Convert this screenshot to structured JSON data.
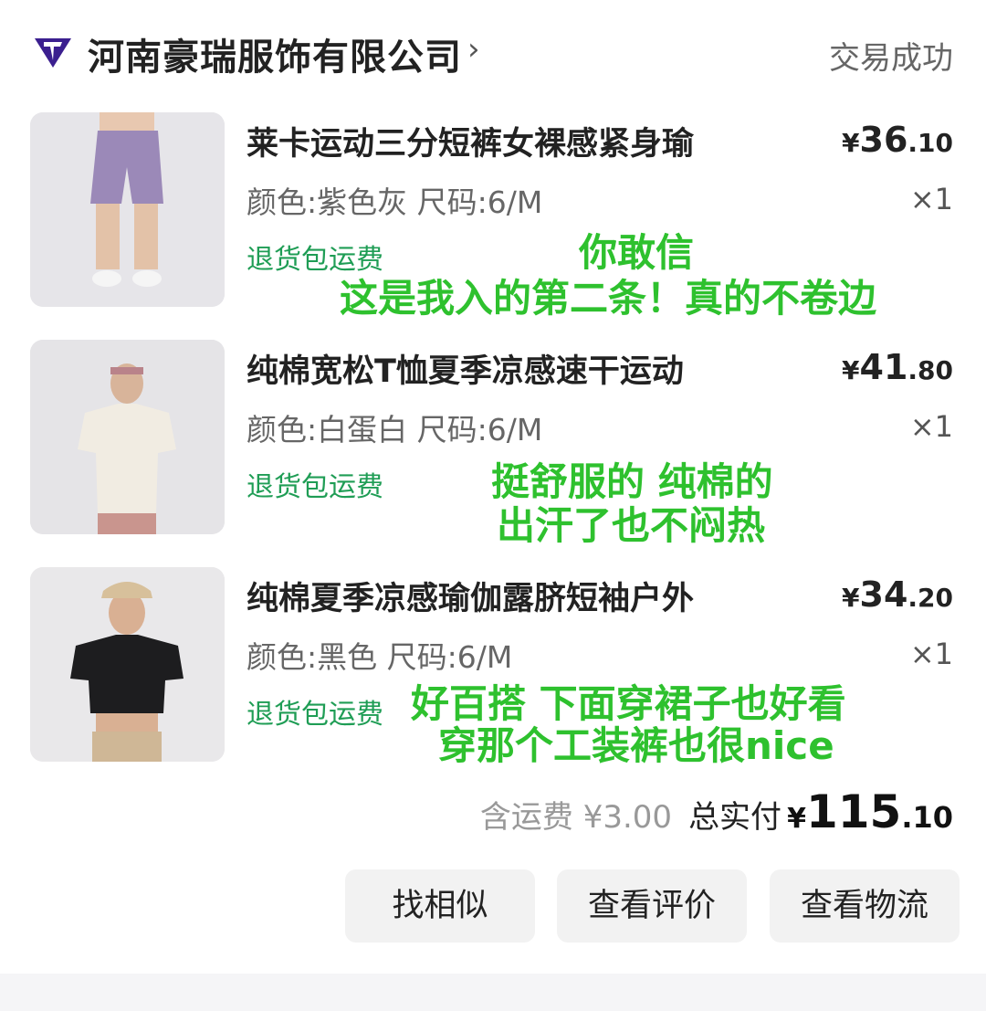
{
  "shop": {
    "name": "河南豪瑞服饰有限公司",
    "arrow": "›",
    "status": "交易成功",
    "logo_icon": "shop-logo-icon",
    "logo_color": "#3b1f8f"
  },
  "items": [
    {
      "title": "莱卡运动三分短裤女裸感紧身瑜",
      "spec": "颜色:紫色灰 尺码:6/M",
      "price_symbol": "¥",
      "price_int": "36",
      "price_dec": ".10",
      "quantity": "×1",
      "tag": "退货包运费",
      "note_lines": [
        "你敢信",
        "这是我入的第二条！真的不卷边"
      ]
    },
    {
      "title": "纯棉宽松T恤夏季凉感速干运动",
      "spec": "颜色:白蛋白 尺码:6/M",
      "price_symbol": "¥",
      "price_int": "41",
      "price_dec": ".80",
      "quantity": "×1",
      "tag": "退货包运费",
      "note_lines": [
        "挺舒服的 纯棉的",
        "出汗了也不闷热"
      ]
    },
    {
      "title": "纯棉夏季凉感瑜伽露脐短袖户外",
      "spec": "颜色:黑色 尺码:6/M",
      "price_symbol": "¥",
      "price_int": "34",
      "price_dec": ".20",
      "quantity": "×1",
      "tag": "退货包运费",
      "note_lines": [
        "好百搭 下面穿裙子也好看",
        "穿那个工装裤也很nice"
      ]
    }
  ],
  "summary": {
    "shipping": "含运费 ¥3.00",
    "total_label": "总实付",
    "total_symbol": "¥",
    "total_int": "115",
    "total_dec": ".10"
  },
  "buttons": {
    "similar": "找相似",
    "review": "查看评价",
    "logistics": "查看物流"
  },
  "colors": {
    "note_green": "#2ec12e",
    "tag_green": "#1f9d55",
    "button_bg": "#f2f2f2"
  }
}
